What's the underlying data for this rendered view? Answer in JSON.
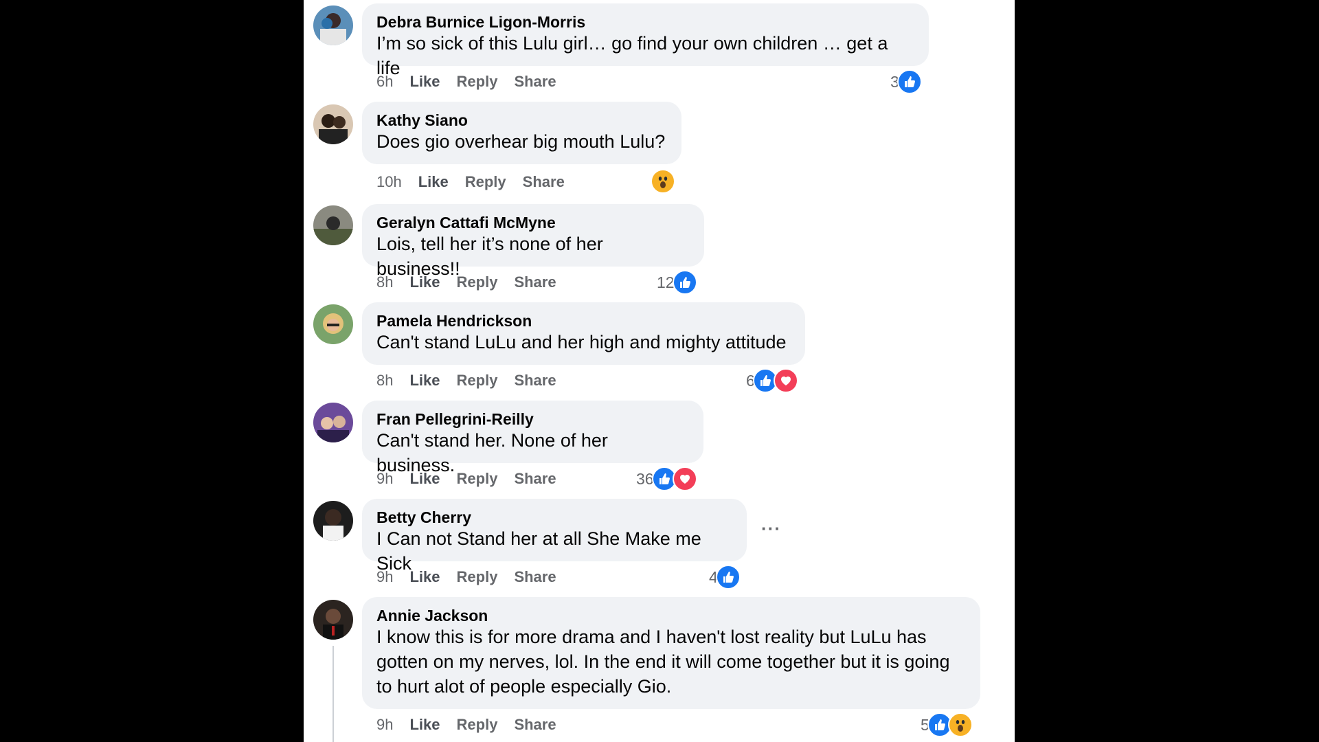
{
  "comments": [
    {
      "author": "Debra Burnice Ligon-Morris",
      "text": "I’m so sick of this Lulu girl… go find your own children … get a life",
      "time": "6h",
      "like": "Like",
      "reply": "Reply",
      "share": "Share",
      "reaction_count": "3",
      "reactions": [
        "like"
      ]
    },
    {
      "author": "Kathy Siano",
      "text": "Does gio overhear big mouth Lulu?",
      "time": "10h",
      "like": "Like",
      "reply": "Reply",
      "share": "Share",
      "reaction_count": "",
      "reactions": [
        "wow"
      ]
    },
    {
      "author": "Geralyn Cattafi McMyne",
      "text": "Lois, tell her it’s none of her business!!",
      "time": "8h",
      "like": "Like",
      "reply": "Reply",
      "share": "Share",
      "reaction_count": "12",
      "reactions": [
        "like"
      ]
    },
    {
      "author": "Pamela Hendrickson",
      "text": "Can't stand LuLu and her high and mighty attitude",
      "time": "8h",
      "like": "Like",
      "reply": "Reply",
      "share": "Share",
      "reaction_count": "6",
      "reactions": [
        "like",
        "love"
      ]
    },
    {
      "author": "Fran Pellegrini-Reilly",
      "text": "Can't stand her. None of her business.",
      "time": "9h",
      "like": "Like",
      "reply": "Reply",
      "share": "Share",
      "reaction_count": "36",
      "reactions": [
        "like",
        "love"
      ]
    },
    {
      "author": "Betty Cherry",
      "text": "I Can not Stand her at all She Make me Sick",
      "time": "9h",
      "like": "Like",
      "reply": "Reply",
      "share": "Share",
      "reaction_count": "4",
      "reactions": [
        "like"
      ],
      "more": "···"
    },
    {
      "author": "Annie Jackson",
      "text": "I know this is for more drama and I haven't lost reality but LuLu has gotten on my nerves, lol. In the end it will come together but it is going to hurt alot of people especially Gio.",
      "time": "9h",
      "like": "Like",
      "reply": "Reply",
      "share": "Share",
      "reaction_count": "5",
      "reactions": [
        "like",
        "wow"
      ]
    }
  ],
  "colors": {
    "like": "#1877f2",
    "love": "#f33e58",
    "wow": "#f7b125",
    "bubble": "#f0f2f5"
  },
  "icons": {
    "like": "thumbs-up-icon",
    "love": "heart-icon",
    "wow": "wow-face-icon"
  }
}
